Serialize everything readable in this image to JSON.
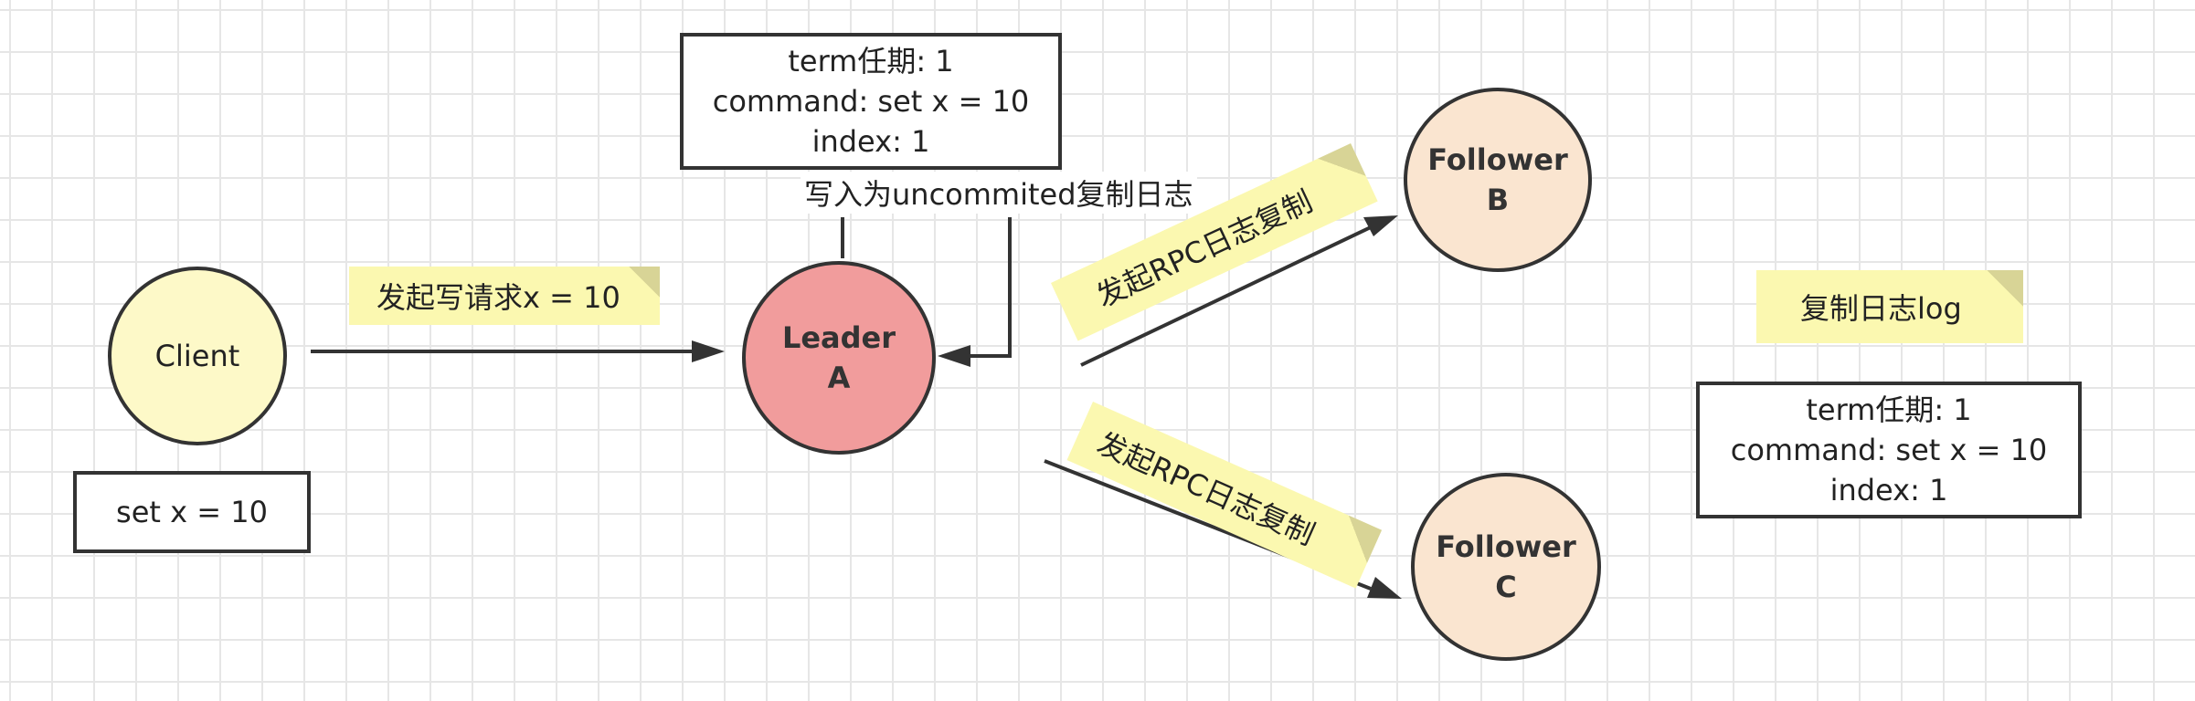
{
  "colors": {
    "client_fill": "#fdf9c8",
    "leader_fill": "#f19c9c",
    "follower_fill": "#fae5d0",
    "note_fill": "#fbf8b0",
    "note_fold": "#d8d496",
    "stroke": "#333333"
  },
  "client": {
    "label": "Client",
    "command_box": "set x = 10"
  },
  "leader": {
    "line1": "Leader",
    "line2": "A"
  },
  "leader_log": {
    "line1": "term任期: 1",
    "line2": "command: set x = 10",
    "line3": "index: 1"
  },
  "write_uncommitted_label": "写入为uncommited复制日志",
  "follower_b": {
    "line1": "Follower",
    "line2": "B"
  },
  "follower_c": {
    "line1": "Follower",
    "line2": "C"
  },
  "notes": {
    "write_request": "发起写请求x = 10",
    "rpc_to_b": "发起RPC日志复制",
    "rpc_to_c": "发起RPC日志复制",
    "replicated_log": "复制日志log"
  },
  "replicated_log_box": {
    "line1": "term任期: 1",
    "line2": "command: set x = 10",
    "line3": "index: 1"
  }
}
